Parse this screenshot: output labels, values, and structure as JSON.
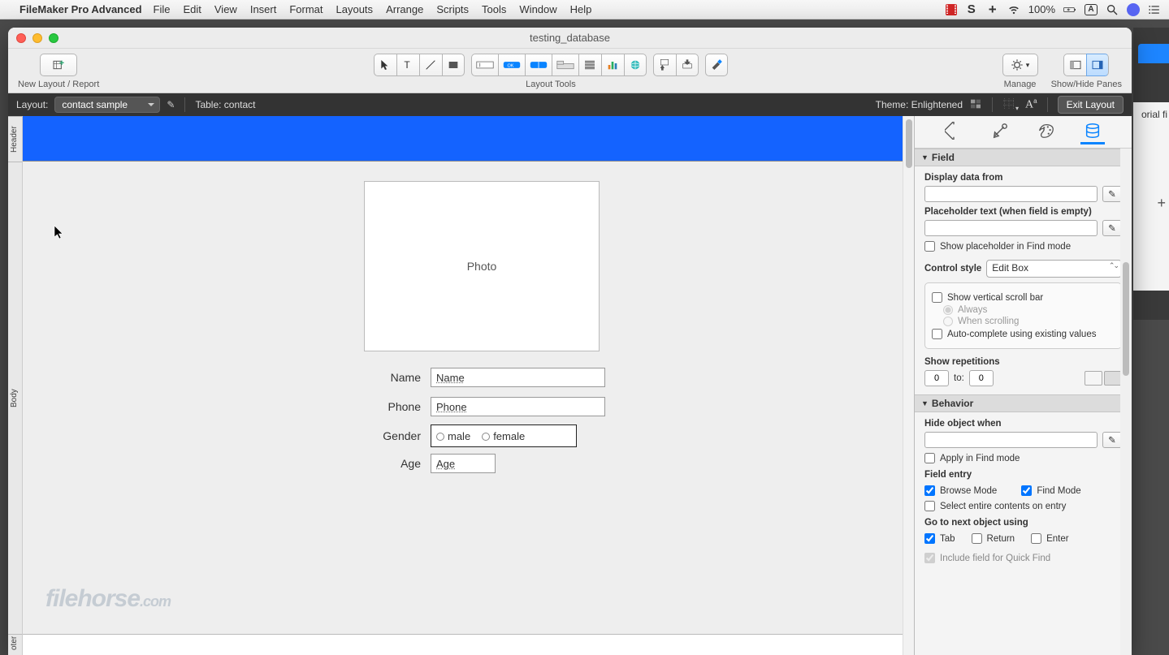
{
  "menubar": {
    "app": "FileMaker Pro Advanced",
    "items": [
      "File",
      "Edit",
      "View",
      "Insert",
      "Format",
      "Layouts",
      "Arrange",
      "Scripts",
      "Tools",
      "Window",
      "Help"
    ],
    "battery": "100%"
  },
  "window": {
    "title": "testing_database"
  },
  "toolbar": {
    "left_label": "New Layout / Report",
    "center_label": "Layout Tools",
    "manage_label": "Manage",
    "panes_label": "Show/Hide Panes"
  },
  "layoutbar": {
    "label": "Layout:",
    "layout_name": "contact sample",
    "table_label": "Table: contact",
    "theme_label": "Theme: Enlightened",
    "exit": "Exit Layout"
  },
  "parts": {
    "header": "Header",
    "body": "Body",
    "footer": "oter"
  },
  "canvas": {
    "photo": "Photo",
    "name_label": "Name",
    "name_field": "Name",
    "phone_label": "Phone",
    "phone_field": "Phone",
    "gender_label": "Gender",
    "gender_opt1": "male",
    "gender_opt2": "female",
    "age_label": "Age",
    "age_field": "Age"
  },
  "inspector": {
    "field_section": "Field",
    "display_data": "Display data from",
    "placeholder_label": "Placeholder text (when field is empty)",
    "show_placeholder_find": "Show placeholder in Find mode",
    "control_style_label": "Control style",
    "control_style_value": "Edit Box",
    "show_scroll": "Show vertical scroll bar",
    "always": "Always",
    "when_scrolling": "When scrolling",
    "autocomplete": "Auto-complete using existing values",
    "show_reps": "Show repetitions",
    "rep_from": "0",
    "rep_to_label": "to:",
    "rep_to": "0",
    "behavior_section": "Behavior",
    "hide_when": "Hide object when",
    "apply_find": "Apply in Find mode",
    "field_entry": "Field entry",
    "browse_mode": "Browse Mode",
    "find_mode": "Find Mode",
    "select_entire": "Select entire contents on entry",
    "goto_next": "Go to next object using",
    "tab": "Tab",
    "return": "Return",
    "enter": "Enter",
    "quick_find": "Include field for Quick Find"
  },
  "bg": {
    "text": "orial fi"
  },
  "wm": {
    "a": "filehorse",
    "b": ".com"
  }
}
